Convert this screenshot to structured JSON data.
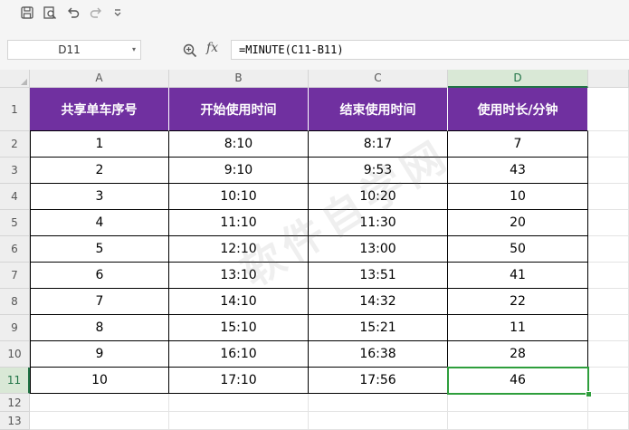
{
  "toolbar": {
    "icons": [
      "save-icon",
      "print-preview-icon",
      "undo-icon",
      "redo-icon",
      "customize-dropdown-icon"
    ]
  },
  "formula_bar": {
    "name_box": "D11",
    "fx_label": "fx",
    "formula": "=MINUTE(C11-B11)"
  },
  "sheet": {
    "columns": [
      "A",
      "B",
      "C",
      "D"
    ],
    "active_column": "D",
    "active_row": "11",
    "row_numbers": [
      "1",
      "2",
      "3",
      "4",
      "5",
      "6",
      "7",
      "8",
      "9",
      "10",
      "11",
      "12",
      "13"
    ],
    "headers": [
      "共享单车序号",
      "开始使用时间",
      "结束使用时间",
      "使用时长/分钟"
    ],
    "rows": [
      [
        "1",
        "8:10",
        "8:17",
        "7"
      ],
      [
        "2",
        "9:10",
        "9:53",
        "43"
      ],
      [
        "3",
        "10:10",
        "10:20",
        "10"
      ],
      [
        "4",
        "11:10",
        "11:30",
        "20"
      ],
      [
        "5",
        "12:10",
        "13:00",
        "50"
      ],
      [
        "6",
        "13:10",
        "13:51",
        "41"
      ],
      [
        "7",
        "14:10",
        "14:32",
        "22"
      ],
      [
        "8",
        "15:10",
        "15:21",
        "11"
      ],
      [
        "9",
        "16:10",
        "16:38",
        "28"
      ],
      [
        "10",
        "17:10",
        "17:56",
        "46"
      ]
    ],
    "header_color": "#7030a0",
    "selection_color": "#2e9e3c"
  },
  "watermark": "软件自学网"
}
